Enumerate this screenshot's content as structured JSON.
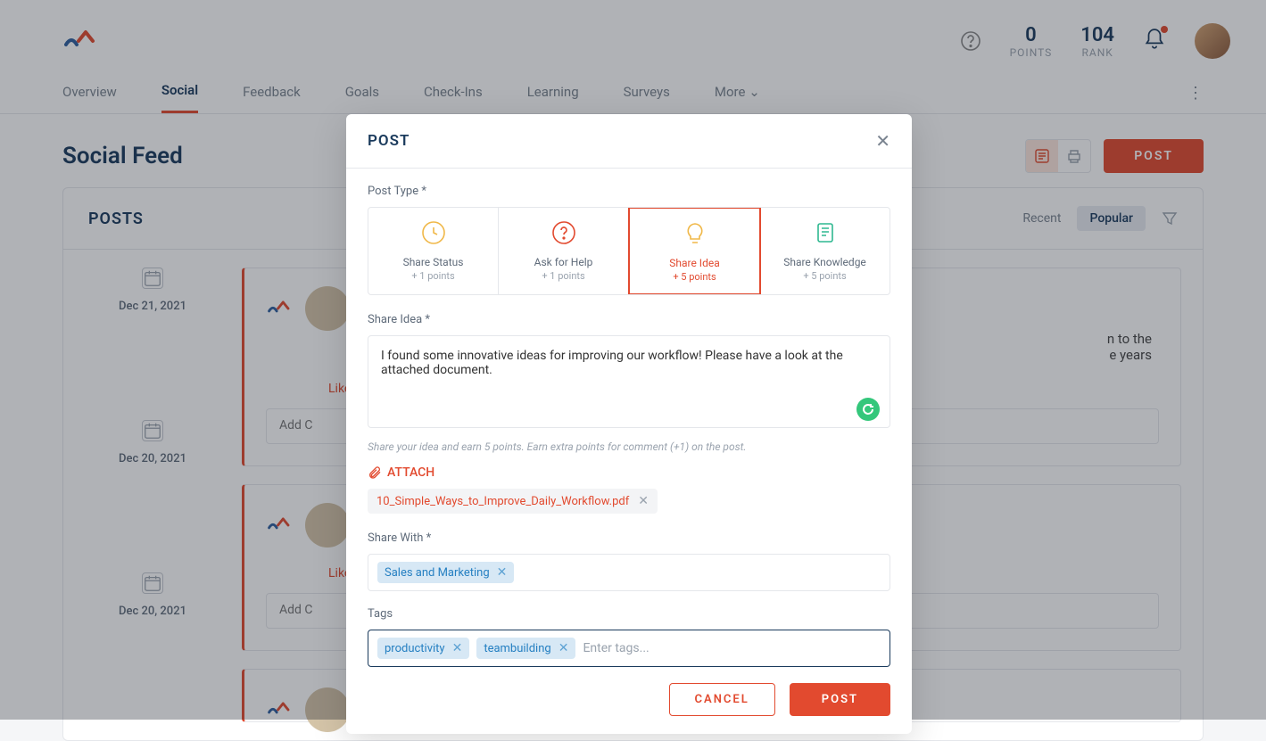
{
  "header": {
    "points_value": "0",
    "points_label": "POINTS",
    "rank_value": "104",
    "rank_label": "RANK"
  },
  "tabs": [
    "Overview",
    "Social",
    "Feedback",
    "Goals",
    "Check-Ins",
    "Learning",
    "Surveys",
    "More"
  ],
  "page": {
    "title": "Social Feed",
    "post_button": "POST"
  },
  "feed": {
    "title": "POSTS",
    "filters": [
      "Recent",
      "Popular"
    ],
    "selected_filter": "Popular",
    "items": [
      {
        "date": "Dec 21, 2021",
        "text_fragment_1": "n to the",
        "text_fragment_2": "e years",
        "like": "Like",
        "comment_placeholder": "Add C"
      },
      {
        "date": "Dec 20, 2021",
        "like": "Like",
        "comment_placeholder": "Add C"
      },
      {
        "date": "Dec 20, 2021"
      }
    ]
  },
  "modal": {
    "title": "POST",
    "post_type_label": "Post Type *",
    "types": [
      {
        "name": "Share Status",
        "points": "+ 1 points"
      },
      {
        "name": "Ask for Help",
        "points": "+ 1 points"
      },
      {
        "name": "Share Idea",
        "points": "+ 5 points"
      },
      {
        "name": "Share Knowledge",
        "points": "+ 5 points"
      }
    ],
    "selected_type_index": 2,
    "idea_label": "Share Idea *",
    "idea_text": "I found some innovative ideas for improving our workflow! Please have a look at the attached document.",
    "hint": "Share your idea and earn 5 points. Earn extra points for comment (+1) on the post.",
    "attach_label": "ATTACH",
    "attachment": "10_Simple_Ways_to_Improve_Daily_Workflow.pdf",
    "share_label": "Share With *",
    "share_with": [
      "Sales and Marketing"
    ],
    "tags_label": "Tags",
    "tags": [
      "productivity",
      "teambuilding"
    ],
    "tags_placeholder": "Enter tags...",
    "cancel": "CANCEL",
    "submit": "POST"
  }
}
